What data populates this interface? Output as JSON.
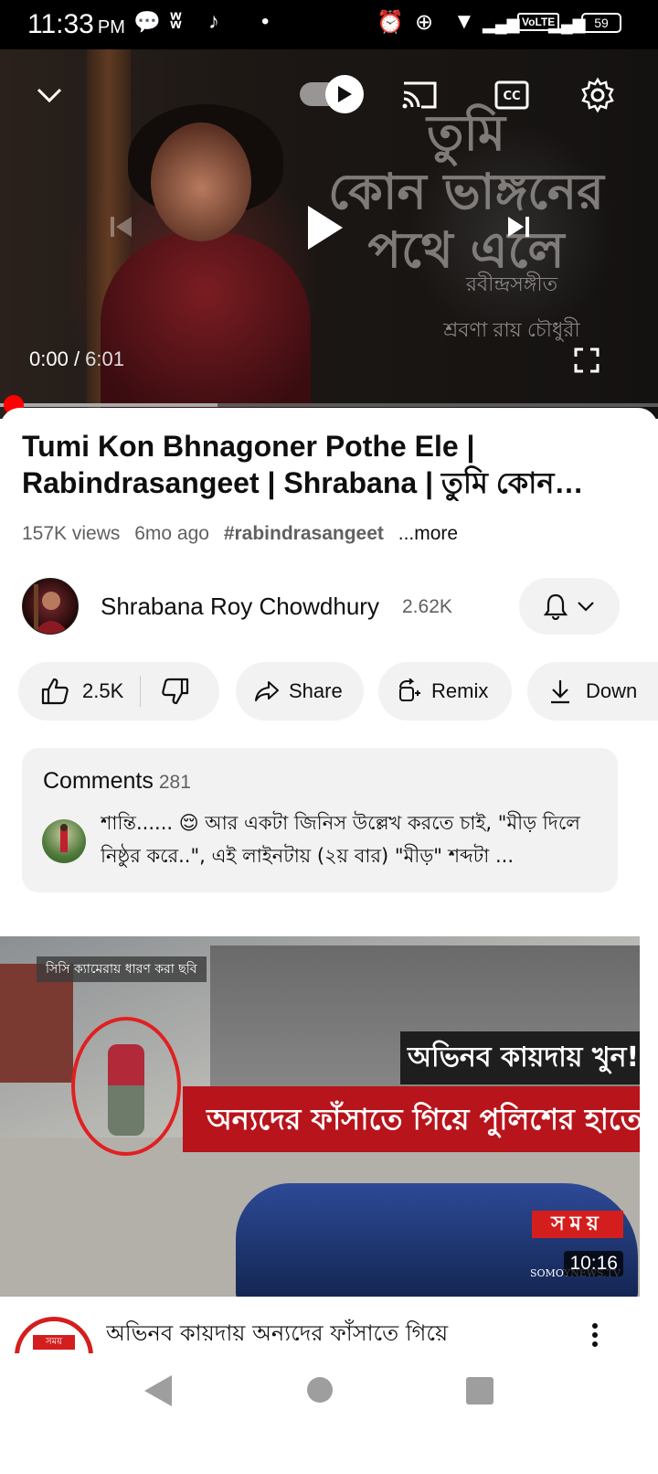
{
  "status_bar": {
    "time": "11:33",
    "ampm": "PM",
    "volte": "VoLTE",
    "battery": "59"
  },
  "player": {
    "art_title_lines": [
      "তুমি",
      "কোন ভাঙ্গনের",
      "পথে এলে"
    ],
    "art_subtitle": "রবীন্দ্রসঙ্গীত",
    "art_artist": "শ্রবণা রায় চৌধুরী",
    "current_time": "0:00",
    "duration": "6:01",
    "progress_fraction": 0.0,
    "buffered_fraction": 0.33,
    "autoplay_on": true
  },
  "video": {
    "title": "Tumi Kon Bhnagoner Pothe Ele | Rabindrasangeet | Shrabana | তুমি কোন ভাঙ্গনের পথে এলে",
    "views": "157K views",
    "age": "6mo ago",
    "hashtag": "#rabindrasangeet",
    "more": "...more"
  },
  "channel": {
    "name": "Shrabana Roy Chowdhury",
    "subscribers": "2.62K"
  },
  "actions": {
    "likes": "2.5K",
    "share": "Share",
    "remix": "Remix",
    "download": "Down"
  },
  "comments": {
    "header": "Comments",
    "count": "281",
    "top_comment": "শান্তি...... 😌 আর একটা জিনিস উল্লেখ করতে চাই, \"মীড় দিলে নিষ্ঠুর করে..\", এই লাইনটায় (২য় বার) \"মীড়\" শব্দটা ..."
  },
  "next_video": {
    "thumb_cctv_label": "সিসি ক্যামেরায় ধারণ করা ছবি",
    "thumb_headline1": "অভিনব কায়দায় খুন!",
    "thumb_headline2": "অন্যদের ফাঁসাতে গিয়ে পুলিশের হাতে ধরা",
    "thumb_brand": "সময়",
    "thumb_site": "SOMOYNEWS.TV",
    "duration": "10:16",
    "channel_logo_text": "সময়",
    "title": "অভিনব কায়দায় অন্যদের ফাঁসাতে গিয়ে"
  },
  "colors": {
    "accent_red": "#ff0000",
    "pill_bg": "#f2f2f2",
    "secondary_text": "#606060"
  }
}
